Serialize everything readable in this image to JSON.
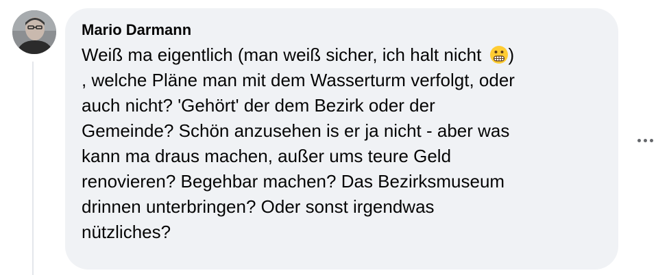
{
  "comment": {
    "author": "Mario Darmann",
    "lines": [
      "Weiß ma eigentlich (man weiß sicher, ich halt nicht ",
      ", welche Pläne man mit dem Wasserturm verfolgt, oder",
      "auch nicht? 'Gehört' der dem Bezirk oder der",
      "Gemeinde? Schön anzusehen is er ja nicht - aber was",
      "kann ma draus machen, außer ums teure Geld",
      "renovieren? Begehbar machen? Das Bezirksmuseum",
      "drinnen unterbringen? Oder sonst irgendwas",
      "nützliches?"
    ],
    "emoji_after_line1": "grimacing-face-emoji",
    "line1_close": ")"
  },
  "icons": {
    "avatar": "profile-photo",
    "more": "more-options-icon"
  },
  "colors": {
    "bubble_bg": "#f0f2f5",
    "text": "#050505",
    "icon_gray": "#65676b"
  }
}
